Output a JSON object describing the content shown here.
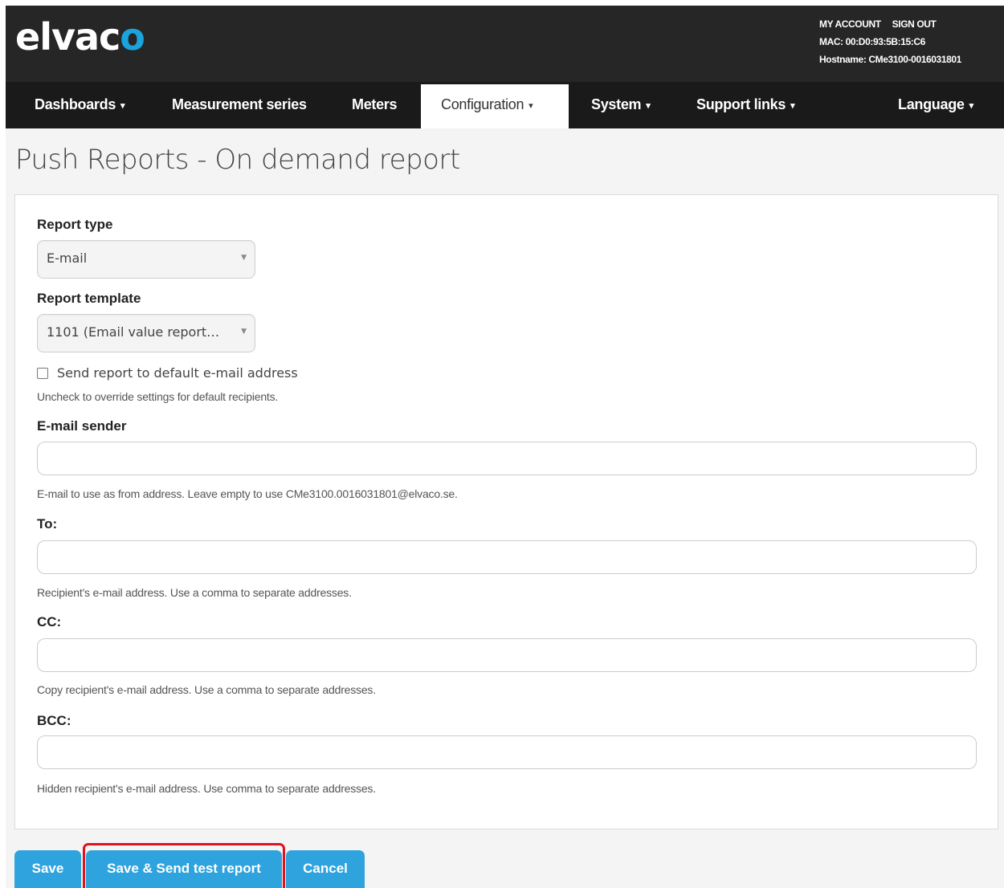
{
  "brand": {
    "logo_main": "elvac",
    "logo_accent": "o",
    "accent_color": "#1aa3dc"
  },
  "account": {
    "my_account": "MY ACCOUNT",
    "sign_out": "SIGN OUT",
    "mac": "MAC: 00:D0:93:5B:15:C6",
    "hostname": "Hostname: CMe3100-0016031801"
  },
  "nav": {
    "dashboards": "Dashboards",
    "measurement_series": "Measurement series",
    "meters": "Meters",
    "configuration": "Configuration",
    "system": "System",
    "support_links": "Support links",
    "language": "Language",
    "caret": "▾",
    "active_item": "Configuration"
  },
  "page": {
    "title": "Push Reports - On demand report"
  },
  "form": {
    "report_type_label": "Report type",
    "report_type_value": "E-mail",
    "report_template_label": "Report template",
    "report_template_value": "1101 (Email value report…",
    "select_arrow": "▼",
    "default_email_label": "Send report to default e-mail address",
    "default_email_checked": false,
    "default_email_help": "Uncheck to override settings for default recipients.",
    "sender_label": "E-mail sender",
    "sender_value": "",
    "sender_help": "E-mail to use as from address. Leave empty to use CMe3100.0016031801@elvaco.se.",
    "to_label": "To:",
    "to_value": "",
    "to_help": "Recipient's e-mail address. Use a comma to separate addresses.",
    "cc_label": "CC:",
    "cc_value": "",
    "cc_help": "Copy recipient's e-mail address. Use a comma to separate addresses.",
    "bcc_label": "BCC:",
    "bcc_value": "",
    "bcc_help": "Hidden recipient's e-mail address. Use comma to separate addresses."
  },
  "buttons": {
    "save": "Save",
    "save_send": "Save & Send test report",
    "cancel": "Cancel",
    "button_color": "#2fa3dd",
    "highlight_color": "#e0121e"
  }
}
